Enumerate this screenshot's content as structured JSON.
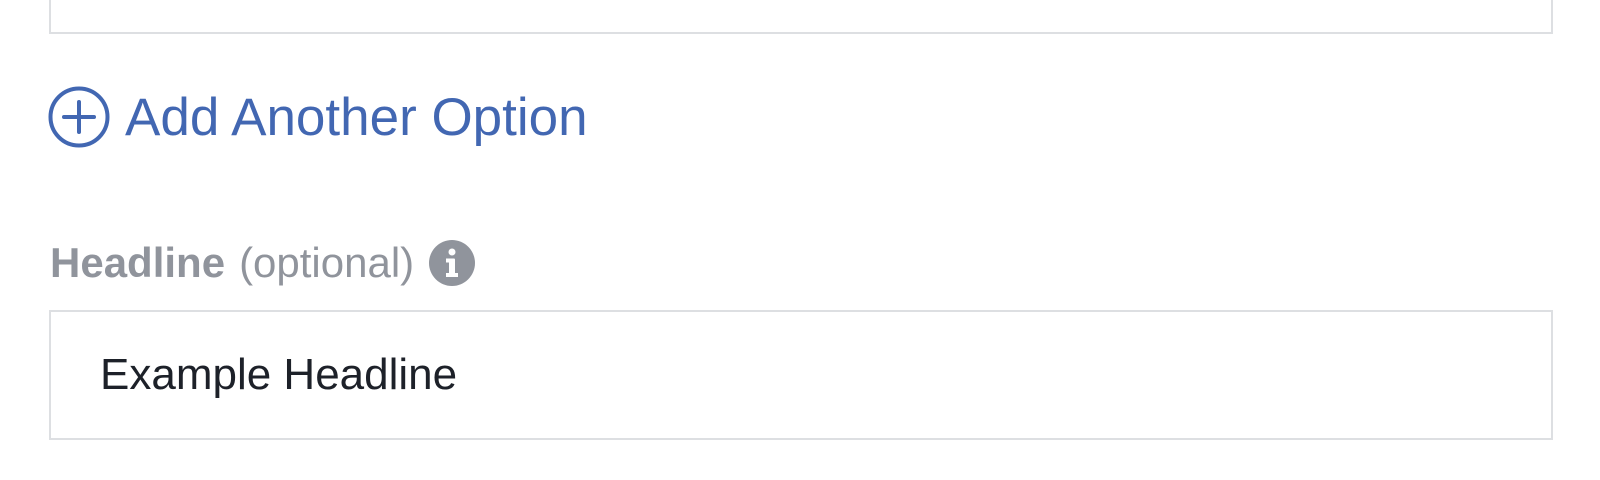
{
  "add_option": {
    "label": "Add Another Option",
    "icon": "plus-circle-icon",
    "color": "#4267b2"
  },
  "headline": {
    "label": "Headline",
    "optional_text": "(optional)",
    "info_icon": "info-icon",
    "value": "Example Headline",
    "placeholder": ""
  },
  "colors": {
    "link": "#4267b2",
    "label": "#90949c",
    "input_text": "#1d2129",
    "border": "#dddfe2"
  }
}
